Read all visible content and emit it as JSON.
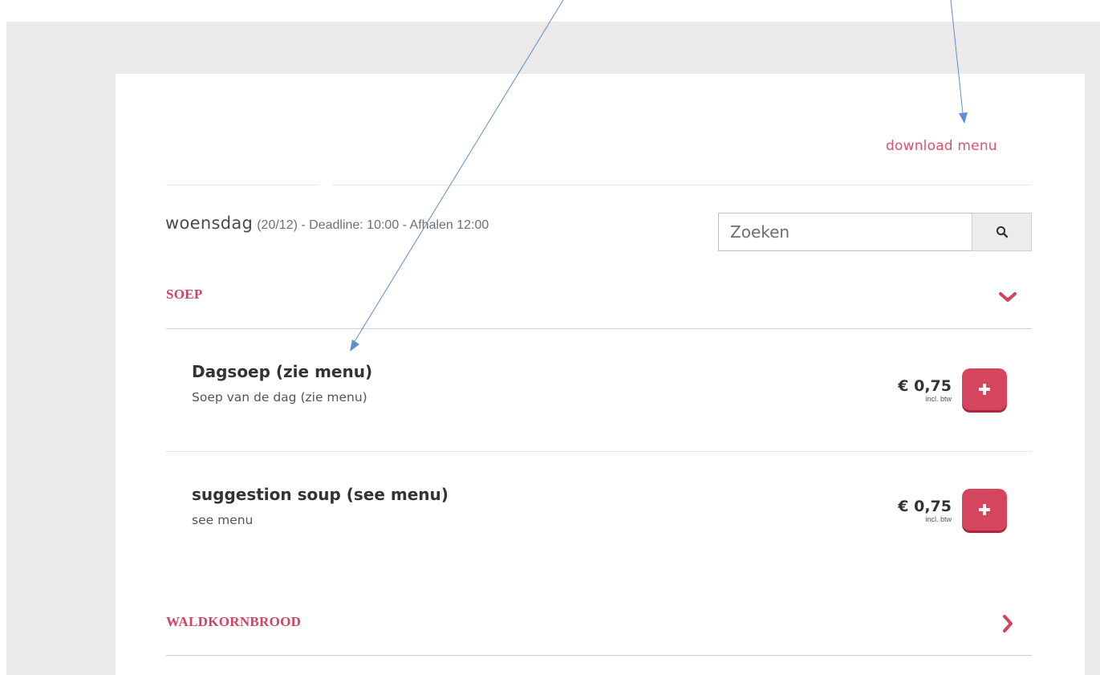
{
  "header": {
    "download_link": "download menu"
  },
  "day": {
    "name": "woensdag",
    "details": "(20/12) - Deadline: 10:00 - Afhalen 12:00"
  },
  "search": {
    "placeholder": "Zoeken",
    "icon": "search-icon"
  },
  "categories": [
    {
      "title": "SOEP",
      "state": "expanded",
      "icon": "chevron-down-icon",
      "items": [
        {
          "name": "Dagsoep (zie menu)",
          "description": "Soep van de dag (zie menu)",
          "price": "€ 0,75",
          "price_note": "incl. btw",
          "add_icon": "plus-icon"
        },
        {
          "name": "suggestion soup (see menu)",
          "description": "see menu",
          "price": "€ 0,75",
          "price_note": "incl. btw",
          "add_icon": "plus-icon"
        }
      ]
    },
    {
      "title": "WALDKORNBROOD",
      "state": "collapsed",
      "icon": "chevron-right-icon"
    }
  ],
  "colors": {
    "accent": "#d2435f",
    "add_button": "#d6455e",
    "annotation_arrow": "#5b8fcf",
    "background": "#ebeae8"
  },
  "annotations": {
    "arrows": 2,
    "arrow_color": "#5b8fcf"
  }
}
